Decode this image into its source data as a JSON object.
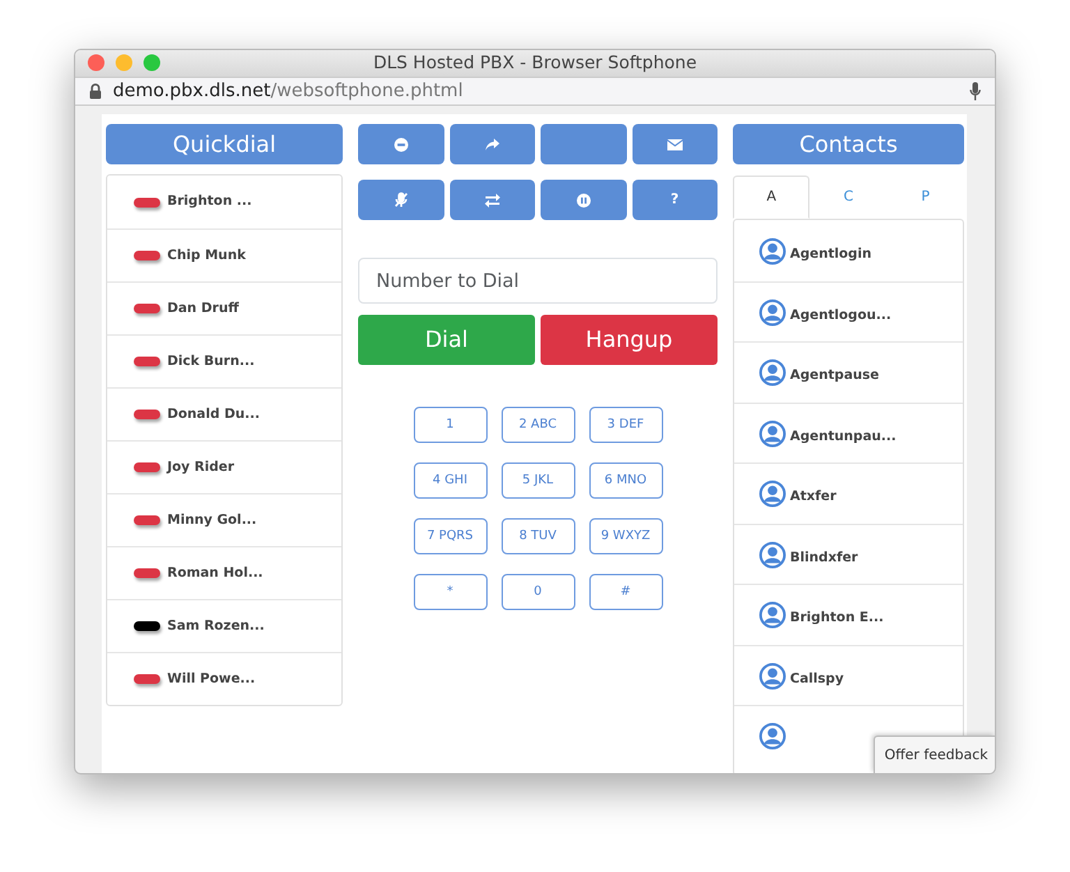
{
  "window": {
    "title": "DLS Hosted PBX - Browser Softphone"
  },
  "address_bar": {
    "host": "demo.pbx.dls.net",
    "path": "/websoftphone.phtml"
  },
  "quickdial": {
    "title": "Quickdial",
    "items": [
      {
        "name": "Brighton ...",
        "color": "#dc3545"
      },
      {
        "name": "Chip Munk",
        "color": "#dc3545"
      },
      {
        "name": "Dan Druff",
        "color": "#dc3545"
      },
      {
        "name": "Dick Burn...",
        "color": "#dc3545"
      },
      {
        "name": "Donald Du...",
        "color": "#dc3545"
      },
      {
        "name": "Joy Rider",
        "color": "#dc3545"
      },
      {
        "name": "Minny Gol...",
        "color": "#dc3545"
      },
      {
        "name": "Roman Hol...",
        "color": "#dc3545"
      },
      {
        "name": "Sam Rozen...",
        "color": "#000000"
      },
      {
        "name": "Will Powe...",
        "color": "#dc3545"
      }
    ]
  },
  "toolbar": {
    "help_label": "?"
  },
  "dial_field": {
    "placeholder": "Number to Dial"
  },
  "dial_button": "Dial",
  "hangup_button": "Hangup",
  "keypad": [
    "1",
    "2 ABC",
    "3 DEF",
    "4 GHI",
    "5 JKL",
    "6 MNO",
    "7 PQRS",
    "8 TUV",
    "9 WXYZ",
    "*",
    "0",
    "#"
  ],
  "contacts": {
    "title": "Contacts",
    "tabs": [
      {
        "label": "A",
        "selected": true
      },
      {
        "label": "C",
        "selected": false
      },
      {
        "label": "P",
        "selected": false
      }
    ],
    "items": [
      {
        "name": "Agentlogin"
      },
      {
        "name": "Agentlogou..."
      },
      {
        "name": "Agentpause"
      },
      {
        "name": "Agentunpau..."
      },
      {
        "name": "Atxfer"
      },
      {
        "name": "Blindxfer"
      },
      {
        "name": "Brighton E..."
      },
      {
        "name": "Callspy"
      }
    ],
    "cut_off_row": true
  },
  "feedback_button": "Offer feedback"
}
